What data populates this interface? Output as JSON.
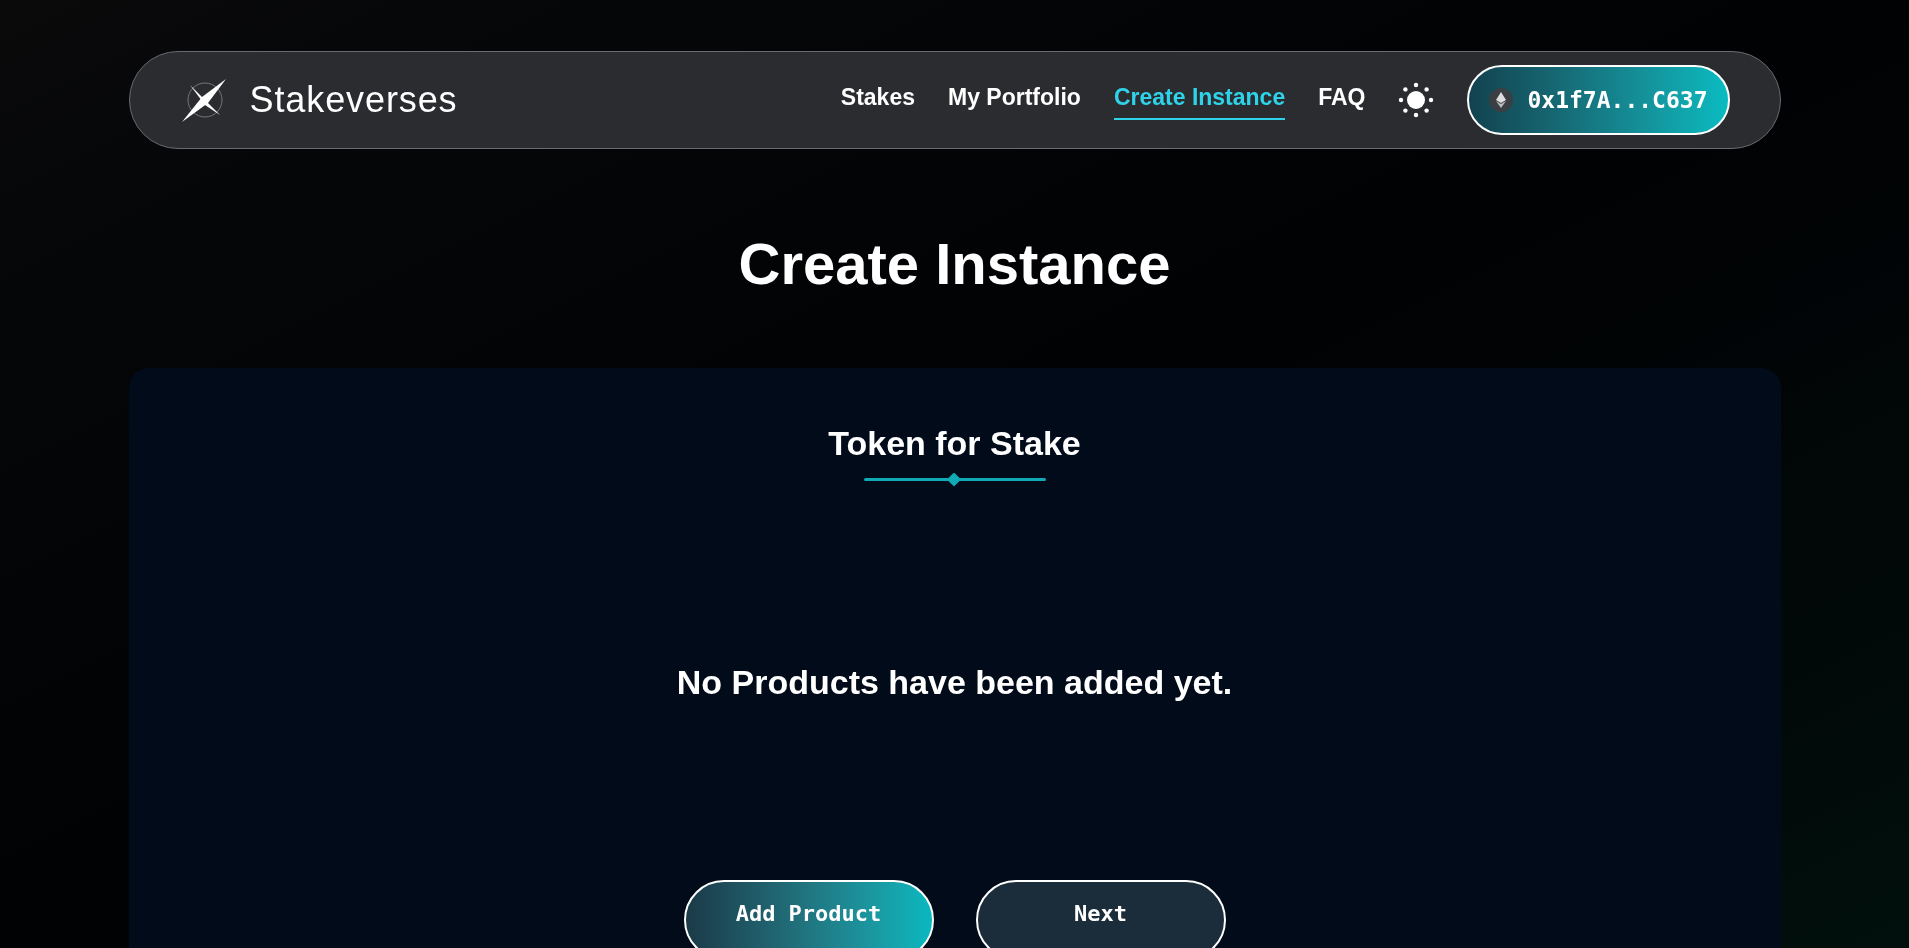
{
  "brand": {
    "name": "Stakeverses"
  },
  "nav": [
    {
      "label": "Stakes",
      "selected": false
    },
    {
      "label": "My Portfolio",
      "selected": false
    },
    {
      "label": "Create Instance",
      "selected": true
    },
    {
      "label": "FAQ",
      "selected": false
    }
  ],
  "wallet": {
    "address": "0x1f7A...C637"
  },
  "page_title": "Create Instance",
  "card": {
    "heading": "Token for Stake",
    "empty_message": "No Products have been added yet.",
    "buttons": [
      {
        "label": "Add Product",
        "kind": "primary"
      },
      {
        "label": "Next",
        "kind": "secondary"
      }
    ]
  }
}
